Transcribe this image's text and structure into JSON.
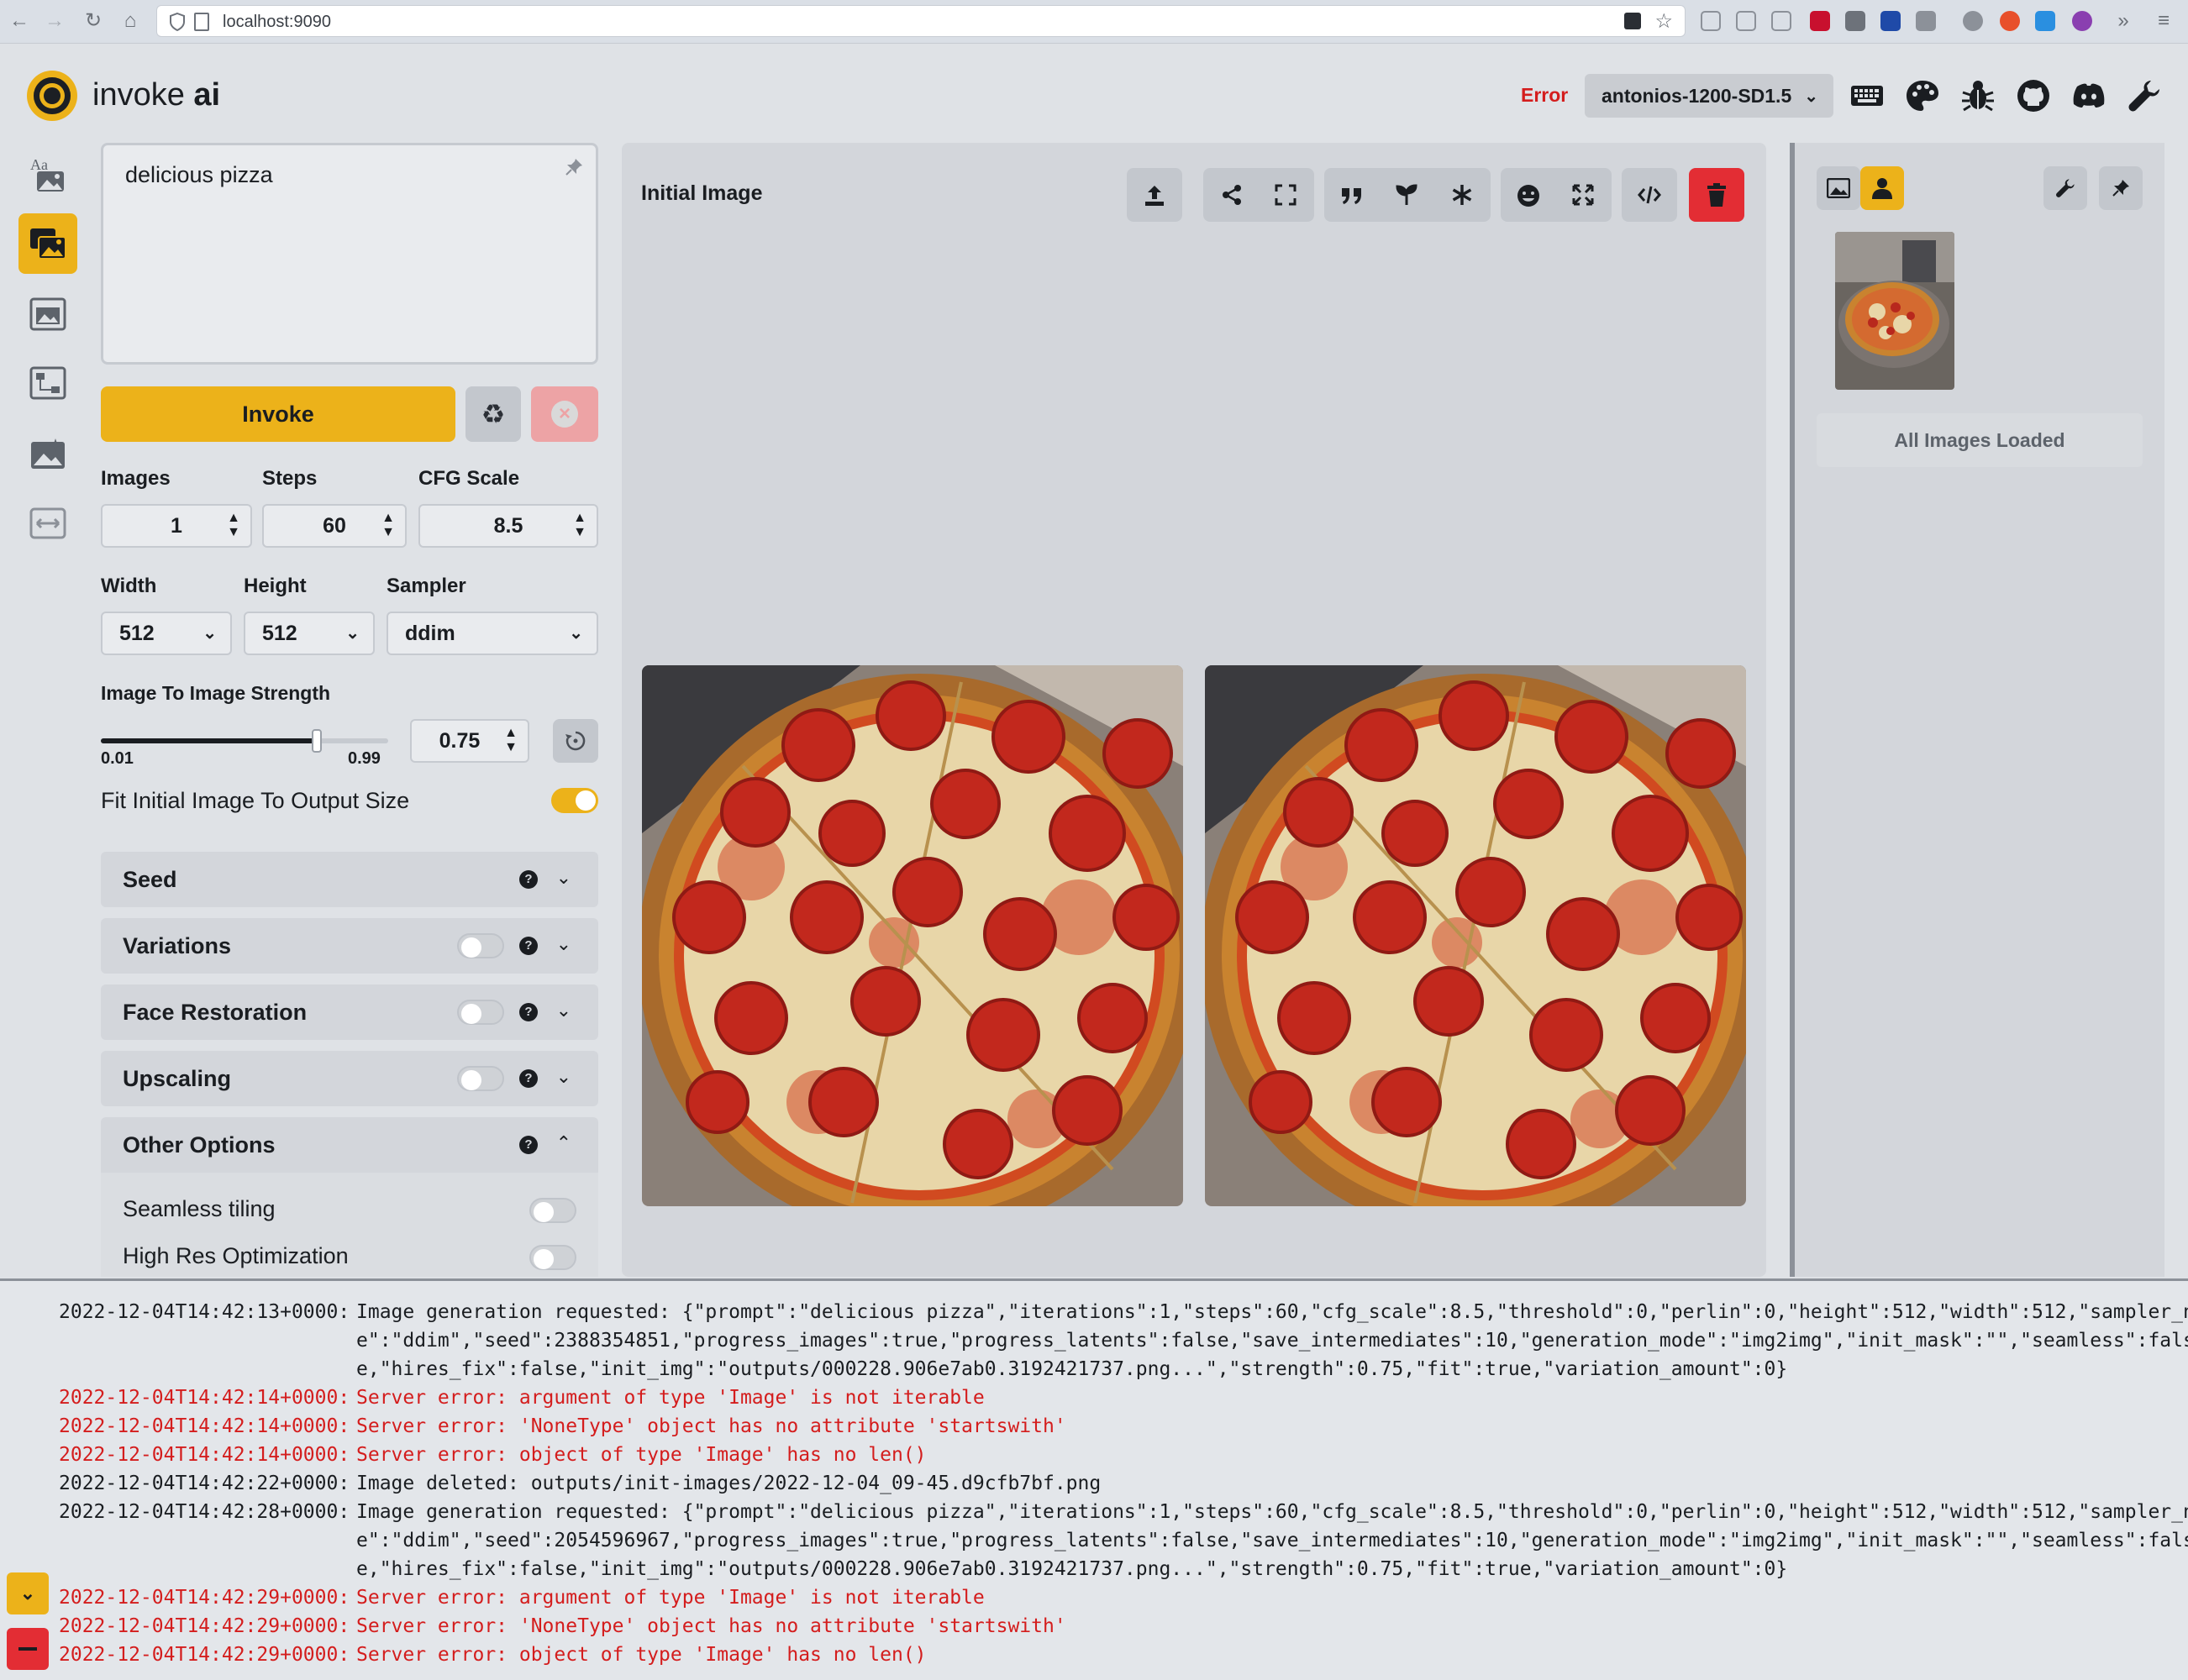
{
  "browser": {
    "url": "localhost:9090"
  },
  "header": {
    "logo_text_light": "invoke ",
    "logo_text_bold": "ai",
    "status": "Error",
    "model": "antonios-1200-SD1.5",
    "icons": [
      "keyboard-icon",
      "palette-icon",
      "bug-icon",
      "github-icon",
      "discord-icon",
      "wrench-icon"
    ]
  },
  "tabs": [
    "text-to-image",
    "image-to-image",
    "unified-canvas",
    "nodes",
    "postprocessing",
    "training"
  ],
  "prompt": {
    "value": "delicious pizza"
  },
  "actions": {
    "invoke": "Invoke"
  },
  "params": {
    "images_label": "Images",
    "images_value": "1",
    "steps_label": "Steps",
    "steps_value": "60",
    "cfg_label": "CFG Scale",
    "cfg_value": "8.5",
    "width_label": "Width",
    "width_value": "512",
    "height_label": "Height",
    "height_value": "512",
    "sampler_label": "Sampler",
    "sampler_value": "ddim"
  },
  "strength": {
    "label": "Image To Image Strength",
    "min": "0.01",
    "max": "0.99",
    "value": "0.75",
    "fraction": 0.75
  },
  "fit": {
    "label": "Fit Initial Image To Output Size",
    "on": true
  },
  "accordions": {
    "seed": "Seed",
    "variations": "Variations",
    "face_restoration": "Face Restoration",
    "upscaling": "Upscaling",
    "other_options": "Other Options",
    "help": "?"
  },
  "other_options": {
    "seamless": "Seamless tiling",
    "hires": "High Res Optimization"
  },
  "viewer": {
    "title": "Initial Image"
  },
  "gallery": {
    "all_loaded": "All Images Loaded"
  },
  "console": [
    {
      "ts": "2022-12-04T14:42:13+0000:",
      "msg": "Image generation requested: {\"prompt\":\"delicious pizza\",\"iterations\":1,\"steps\":60,\"cfg_scale\":8.5,\"threshold\":0,\"perlin\":0,\"height\":512,\"width\":512,\"sampler_name\":\"ddim\",\"seed\":2388354851,\"progress_images\":true,\"progress_latents\":false,\"save_intermediates\":10,\"generation_mode\":\"img2img\",\"init_mask\":\"\",\"seamless\":false,\"hires_fix\":false,\"init_img\":\"outputs/000228.906e7ab0.3192421737.png...\",\"strength\":0.75,\"fit\":true,\"variation_amount\":0}",
      "error": false
    },
    {
      "ts": "2022-12-04T14:42:14+0000:",
      "msg": "Server error: argument of type 'Image' is not iterable",
      "error": true
    },
    {
      "ts": "2022-12-04T14:42:14+0000:",
      "msg": "Server error: 'NoneType' object has no attribute 'startswith'",
      "error": true
    },
    {
      "ts": "2022-12-04T14:42:14+0000:",
      "msg": "Server error: object of type 'Image' has no len()",
      "error": true
    },
    {
      "ts": "2022-12-04T14:42:22+0000:",
      "msg": "Image deleted: outputs/init-images/2022-12-04_09-45.d9cfb7bf.png",
      "error": false
    },
    {
      "ts": "2022-12-04T14:42:28+0000:",
      "msg": "Image generation requested: {\"prompt\":\"delicious pizza\",\"iterations\":1,\"steps\":60,\"cfg_scale\":8.5,\"threshold\":0,\"perlin\":0,\"height\":512,\"width\":512,\"sampler_name\":\"ddim\",\"seed\":2054596967,\"progress_images\":true,\"progress_latents\":false,\"save_intermediates\":10,\"generation_mode\":\"img2img\",\"init_mask\":\"\",\"seamless\":false,\"hires_fix\":false,\"init_img\":\"outputs/000228.906e7ab0.3192421737.png...\",\"strength\":0.75,\"fit\":true,\"variation_amount\":0}",
      "error": false
    },
    {
      "ts": "2022-12-04T14:42:29+0000:",
      "msg": "Server error: argument of type 'Image' is not iterable",
      "error": true
    },
    {
      "ts": "2022-12-04T14:42:29+0000:",
      "msg": "Server error: 'NoneType' object has no attribute 'startswith'",
      "error": true
    },
    {
      "ts": "2022-12-04T14:42:29+0000:",
      "msg": "Server error: object of type 'Image' has no len()",
      "error": true
    }
  ]
}
